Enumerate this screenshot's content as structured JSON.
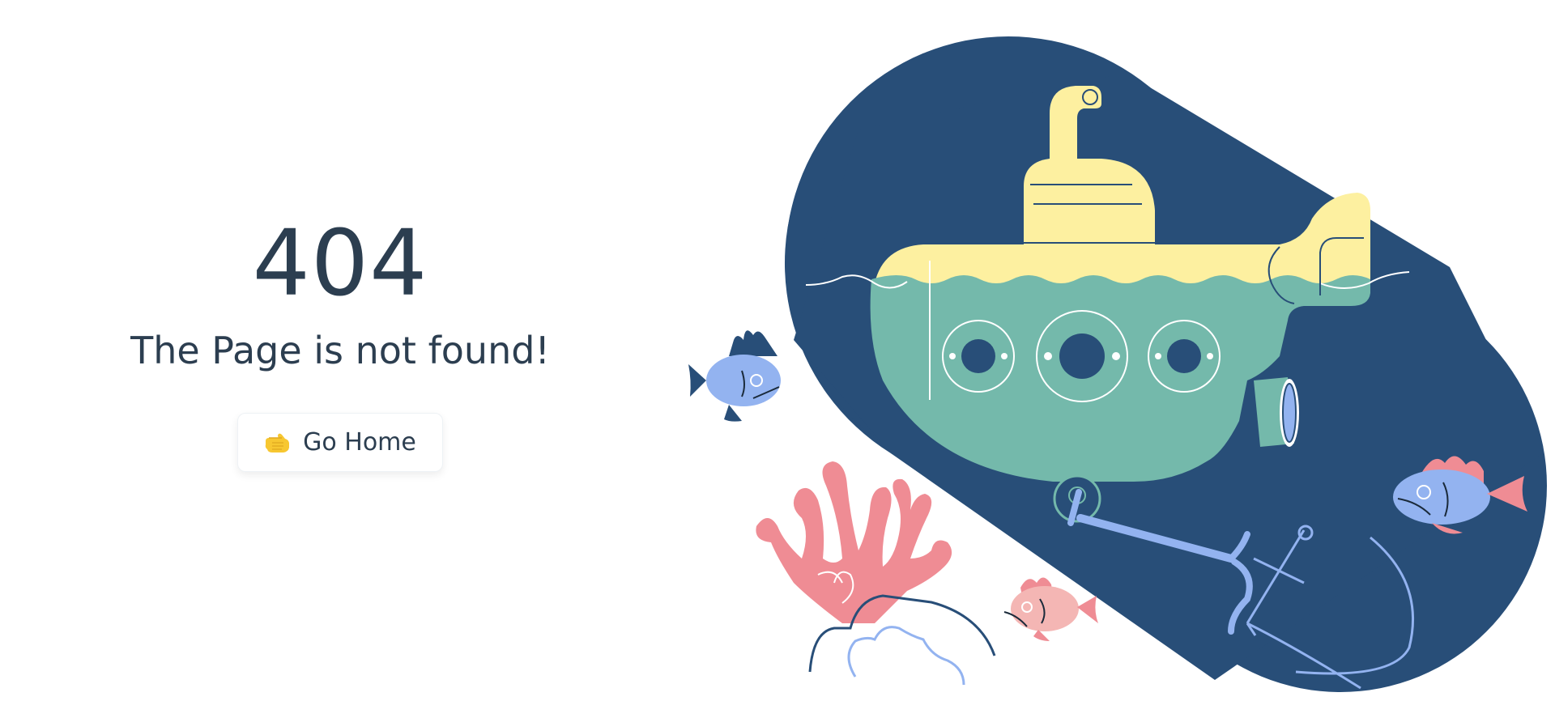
{
  "error": {
    "code": "404",
    "message": "The Page is not found!"
  },
  "actions": {
    "home_label": "Go Home",
    "home_icon": "pointing-right-hand-icon"
  },
  "illustration": {
    "name": "submarine-underwater-illustration",
    "colors": {
      "deep_blue": "#284e78",
      "sub_yellow": "#fdf0a0",
      "sub_teal": "#74b9ab",
      "fish_blue": "#93b3f0",
      "coral_pink": "#ef8c94",
      "fish_pink": "#f4b6b4"
    }
  }
}
